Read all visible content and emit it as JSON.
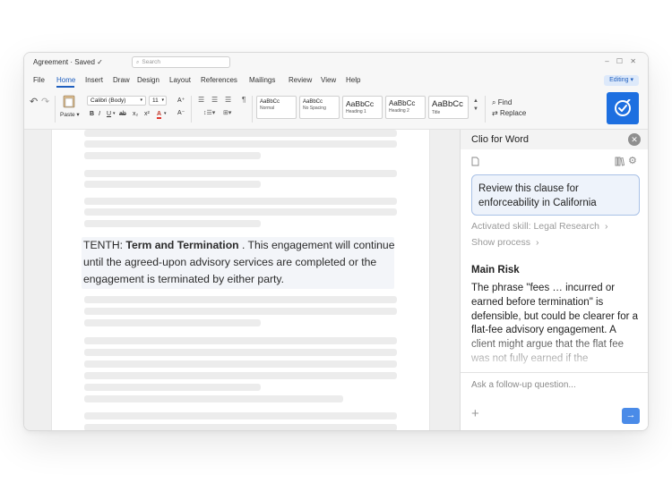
{
  "titlebar": {
    "doc_title": "Agreement · Saved ✓",
    "search_placeholder": "Search",
    "window_controls": "– ☐ ✕"
  },
  "menu": {
    "items": [
      "File",
      "Home",
      "Insert",
      "Draw",
      "Design",
      "Layout",
      "References",
      "Mailings",
      "Review",
      "View",
      "Help"
    ],
    "active": "Home",
    "editing": "Editing ▾"
  },
  "ribbon": {
    "paste": "Paste ▾",
    "font": "Calibri (Body)",
    "size": "11",
    "styles": [
      {
        "sample": "AaBbCc",
        "name": "Normal"
      },
      {
        "sample": "AaBbCc",
        "name": "No Spacing"
      },
      {
        "sample": "AaBbCc",
        "name": "Heading 1"
      },
      {
        "sample": "AaBbCc",
        "name": "Heading 2"
      },
      {
        "sample": "AaBbCc",
        "name": "Title"
      }
    ],
    "find": "Find",
    "replace": "Replace"
  },
  "document": {
    "clause_lead": "TENTH: ",
    "clause_heading": "Term and Termination",
    "clause_text": " . This engagement will continue until the agreed-upon advisory services are completed or the engagement is terminated by either party."
  },
  "panel": {
    "title": "Clio for Word",
    "prompt": "Review this clause for enforceability in California",
    "skill": "Activated skill: Legal Research",
    "show_process": "Show process",
    "risk_title": "Main Risk",
    "risk_body": "The phrase \"fees … incurred or earned before termination\" is defensible, but could be clearer for a flat-fee advisory engagement. A client might argue that the flat fee was not fully earned if the",
    "followup_placeholder": "Ask a follow-up question..."
  },
  "colors": {
    "accent": "#1d6fe0",
    "active_menu": "#1f5fbf"
  }
}
